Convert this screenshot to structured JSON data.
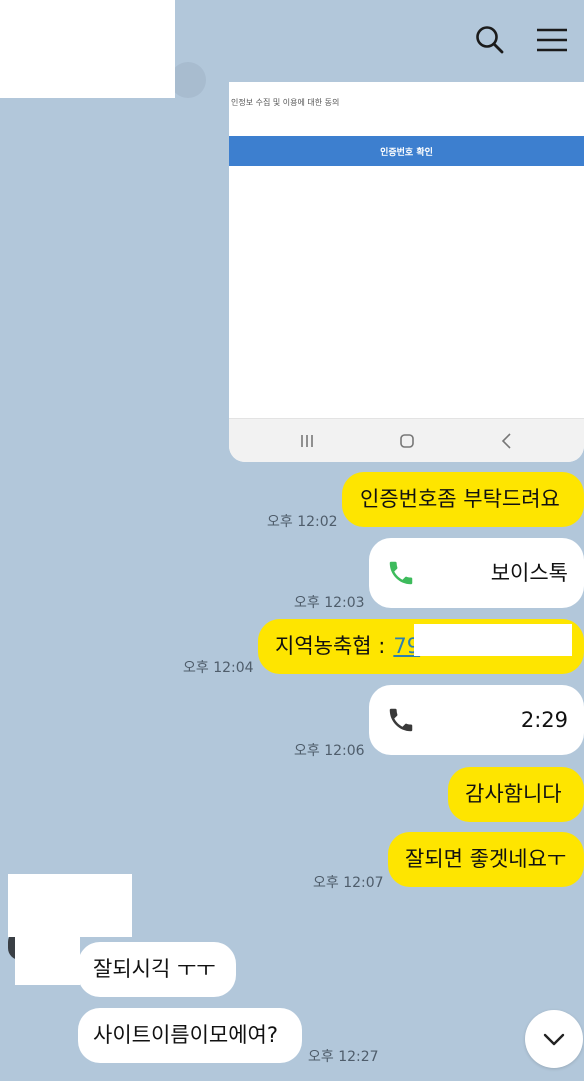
{
  "header": {
    "search_icon": "search-icon",
    "menu_icon": "hamburger-menu-icon"
  },
  "attached_screenshot": {
    "consent_text": "인정보 수집 및 이용에 대한 동의",
    "verify_button_label": "인증번호 확인",
    "nav_icons": [
      "recent-apps-icon",
      "home-icon",
      "back-icon"
    ]
  },
  "messages": [
    {
      "text": "인증번호좀 부탁드려요",
      "time": "오후 12:02"
    },
    {
      "call_label": "보이스톡",
      "time": "오후 12:03"
    },
    {
      "text": "지역농축협 :",
      "phone_prefix": "79",
      "time": "오후 12:04"
    },
    {
      "call_label": "2:29",
      "time": "오후 12:06"
    },
    {
      "text": "감사함니다"
    },
    {
      "text": "잘되면 좋겟네요ㅜ",
      "time": "오후 12:07"
    },
    {
      "text": "잘되시긱 ㅜㅜ"
    },
    {
      "text": "사이트이름이모에여?",
      "time": "오후 12:27"
    }
  ],
  "colors": {
    "background": "#b2c7da",
    "my_bubble": "#fee500",
    "their_bubble": "#ffffff",
    "call_green": "#3dbb5c",
    "verify_blue": "#3d7fcf"
  },
  "scroll_button_icon": "chevron-down-icon"
}
